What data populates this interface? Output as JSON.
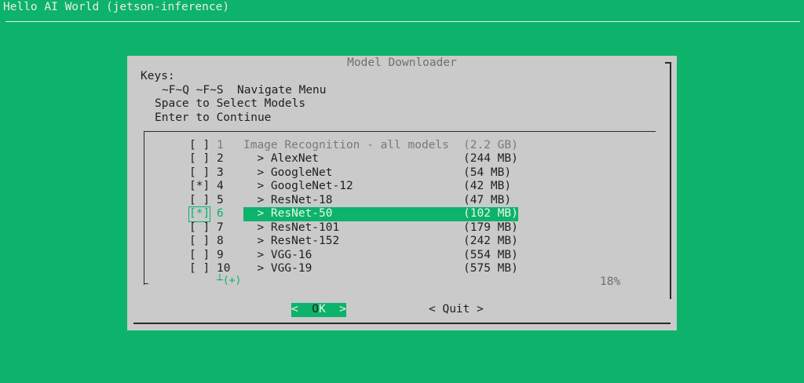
{
  "backtitle": "Hello AI World (jetson-inference)",
  "dialog": {
    "title": "Model Downloader",
    "keys_heading": "Keys:",
    "keys": [
      "~F~Q ~F~S  Navigate Menu",
      "Space to Select Models",
      "Enter to Continue"
    ]
  },
  "list": {
    "rows": [
      {
        "check": "[ ]",
        "num": "1",
        "name": "Image Recognition - all models",
        "size": "(2.2 GB)"
      },
      {
        "check": "[ ]",
        "num": "2",
        "name": "  > AlexNet",
        "size": "(244 MB)"
      },
      {
        "check": "[ ]",
        "num": "3",
        "name": "  > GoogleNet",
        "size": "(54 MB)"
      },
      {
        "check": "[*]",
        "num": "4",
        "name": "  > GoogleNet-12",
        "size": "(42 MB)"
      },
      {
        "check": "[ ]",
        "num": "5",
        "name": "  > ResNet-18",
        "size": "(47 MB)"
      },
      {
        "check": "[*]",
        "num": "6",
        "name": "  > ResNet-50",
        "size": "(102 MB)"
      },
      {
        "check": "[ ]",
        "num": "7",
        "name": "  > ResNet-101",
        "size": "(179 MB)"
      },
      {
        "check": "[ ]",
        "num": "8",
        "name": "  > ResNet-152",
        "size": "(242 MB)"
      },
      {
        "check": "[ ]",
        "num": "9",
        "name": "  > VGG-16",
        "size": "(554 MB)"
      },
      {
        "check": "[ ]",
        "num": "10",
        "name": "  > VGG-19",
        "size": "(575 MB)"
      }
    ],
    "more_indicator": "┴(+)",
    "percent": "18%"
  },
  "buttons": {
    "ok_left": "<  ",
    "ok_hot": "O",
    "ok_rest": "K  >",
    "quit": "< Quit >"
  },
  "colors": {
    "background": "#0db26b",
    "dialog": "#c9cac9",
    "highlight": "#0db26b"
  }
}
